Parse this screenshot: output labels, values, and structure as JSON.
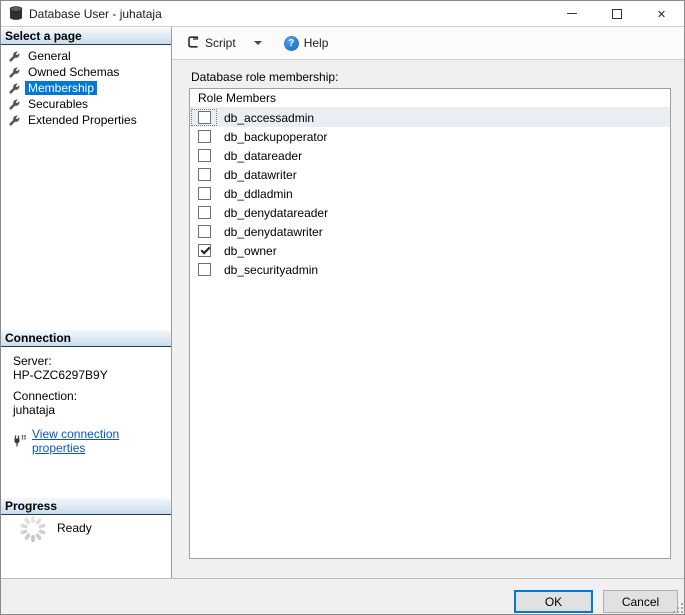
{
  "window": {
    "title": "Database User - juhataja"
  },
  "sidebar": {
    "select_page": {
      "header": "Select a page",
      "items": [
        {
          "label": "General",
          "selected": false
        },
        {
          "label": "Owned Schemas",
          "selected": false
        },
        {
          "label": "Membership",
          "selected": true
        },
        {
          "label": "Securables",
          "selected": false
        },
        {
          "label": "Extended Properties",
          "selected": false
        }
      ]
    },
    "connection": {
      "header": "Connection",
      "server_label": "Server:",
      "server_value": "HP-CZC6297B9Y",
      "connection_label": "Connection:",
      "connection_value": "juhataja",
      "link_label": "View connection properties"
    },
    "progress": {
      "header": "Progress",
      "status": "Ready"
    }
  },
  "toolbar": {
    "script_label": "Script",
    "help_label": "Help"
  },
  "main": {
    "section_label": "Database role membership:",
    "list_header": "Role Members",
    "roles": [
      {
        "name": "db_accessadmin",
        "checked": false,
        "focused": true
      },
      {
        "name": "db_backupoperator",
        "checked": false,
        "focused": false
      },
      {
        "name": "db_datareader",
        "checked": false,
        "focused": false
      },
      {
        "name": "db_datawriter",
        "checked": false,
        "focused": false
      },
      {
        "name": "db_ddladmin",
        "checked": false,
        "focused": false
      },
      {
        "name": "db_denydatareader",
        "checked": false,
        "focused": false
      },
      {
        "name": "db_denydatawriter",
        "checked": false,
        "focused": false
      },
      {
        "name": "db_owner",
        "checked": true,
        "focused": false
      },
      {
        "name": "db_securityadmin",
        "checked": false,
        "focused": false
      }
    ]
  },
  "footer": {
    "ok_label": "OK",
    "cancel_label": "Cancel"
  },
  "colors": {
    "selection": "#0078d7",
    "link": "#0a55c4",
    "panel_header_top": "#f4f9fd",
    "panel_header_bottom": "#c9dcec",
    "row_highlight": "#e8eef4"
  }
}
